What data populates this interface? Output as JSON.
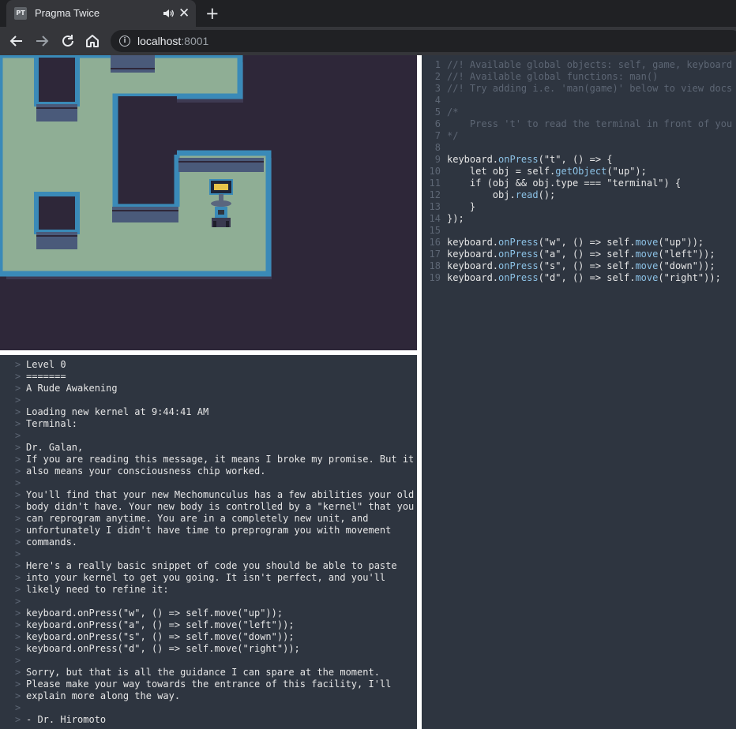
{
  "browser": {
    "favicon_text": "PT",
    "tab_title": "Pragma Twice",
    "new_tab_symbol": "+",
    "close_symbol": "✕",
    "url_host": "localhost",
    "url_port": ":8001"
  },
  "colors": {
    "game_background": "#2e2739",
    "floor": "#8fae95",
    "wall_edge": "#3a8ab8",
    "wall_face": "#4a5a7a",
    "panel_background": "#2e3540",
    "code_function": "#8cc2e6",
    "comment": "#5d6674"
  },
  "terminal": {
    "prompt": ">",
    "lines": [
      "Level 0",
      "=======",
      "A Rude Awakening",
      "",
      "Loading new kernel at 9:44:41 AM",
      "Terminal:",
      "",
      "Dr. Galan,",
      "If you are reading this message, it means I broke my promise. But it",
      "also means your consciousness chip worked.",
      "",
      "You'll find that your new Mechomunculus has a few abilities your old",
      "body didn't have. Your new body is controlled by a \"kernel\" that you",
      "can reprogram anytime. You are in a completely new unit, and",
      "unfortunately I didn't have time to preprogram you with movement",
      "commands.",
      "",
      "Here's a really basic snippet of code you should be able to paste",
      "into your kernel to get you going. It isn't perfect, and you'll",
      "likely need to refine it:",
      "",
      "keyboard.onPress(\"w\", () => self.move(\"up\"));",
      "keyboard.onPress(\"a\", () => self.move(\"left\"));",
      "keyboard.onPress(\"s\", () => self.move(\"down\"));",
      "keyboard.onPress(\"d\", () => self.move(\"right\"));",
      "",
      "Sorry, but that is all the guidance I can spare at the moment.",
      "Please make your way towards the entrance of this facility, I'll",
      "explain more along the way.",
      "",
      "- Dr. Hiromoto"
    ]
  },
  "editor": {
    "lines": [
      [
        [
          "comment",
          "//! Available global objects: self, game, keyboard"
        ]
      ],
      [
        [
          "comment",
          "//! Available global functions: man()"
        ]
      ],
      [
        [
          "comment",
          "//! Try adding i.e. 'man(game)' below to view docs"
        ]
      ],
      [],
      [
        [
          "comment",
          "/*"
        ]
      ],
      [
        [
          "comment",
          "    Press 't' to read the terminal in front of you"
        ]
      ],
      [
        [
          "comment",
          "*/"
        ]
      ],
      [],
      [
        [
          "plain",
          "keyboard."
        ],
        [
          "fn",
          "onPress"
        ],
        [
          "plain",
          "(\"t\", () => {"
        ]
      ],
      [
        [
          "plain",
          "    let obj = self."
        ],
        [
          "fn",
          "getObject"
        ],
        [
          "plain",
          "(\"up\");"
        ]
      ],
      [
        [
          "plain",
          "    if (obj && obj.type === \"terminal\") {"
        ]
      ],
      [
        [
          "plain",
          "        obj."
        ],
        [
          "fn",
          "read"
        ],
        [
          "plain",
          "();"
        ]
      ],
      [
        [
          "plain",
          "    }"
        ]
      ],
      [
        [
          "plain",
          "});"
        ]
      ],
      [],
      [
        [
          "plain",
          "keyboard."
        ],
        [
          "fn",
          "onPress"
        ],
        [
          "plain",
          "(\"w\", () => self."
        ],
        [
          "fn",
          "move"
        ],
        [
          "plain",
          "(\"up\"));"
        ]
      ],
      [
        [
          "plain",
          "keyboard."
        ],
        [
          "fn",
          "onPress"
        ],
        [
          "plain",
          "(\"a\", () => self."
        ],
        [
          "fn",
          "move"
        ],
        [
          "plain",
          "(\"left\"));"
        ]
      ],
      [
        [
          "plain",
          "keyboard."
        ],
        [
          "fn",
          "onPress"
        ],
        [
          "plain",
          "(\"s\", () => self."
        ],
        [
          "fn",
          "move"
        ],
        [
          "plain",
          "(\"down\"));"
        ]
      ],
      [
        [
          "plain",
          "keyboard."
        ],
        [
          "fn",
          "onPress"
        ],
        [
          "plain",
          "(\"d\", () => self."
        ],
        [
          "fn",
          "move"
        ],
        [
          "plain",
          "(\"right\"));"
        ]
      ]
    ]
  }
}
